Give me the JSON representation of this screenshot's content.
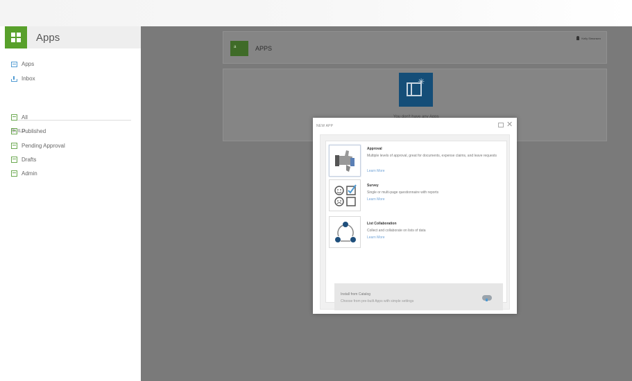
{
  "sidebar": {
    "title": "Apps",
    "items": [
      {
        "label": "Apps",
        "icon": "app-icon"
      },
      {
        "label": "Inbox",
        "icon": "inbox-icon"
      }
    ],
    "build_label": "BUILD",
    "build_items": [
      {
        "label": "All"
      },
      {
        "label": "Published"
      },
      {
        "label": "Pending Approval"
      },
      {
        "label": "Drafts"
      },
      {
        "label": "Admin"
      }
    ]
  },
  "header": {
    "logo_text": "a",
    "title": "APPS",
    "user": "Kelly Simonsen"
  },
  "mid": {
    "text": "You don't have any Apps"
  },
  "modal": {
    "title": "NEW APP",
    "options": [
      {
        "title": "Approval",
        "description": "Multiple levels of approval, great for documents, expense claims, and leave requests",
        "link": "Learn More"
      },
      {
        "title": "Survey",
        "description": "Single or multi-page questionnaire with reports",
        "link": "Learn More"
      },
      {
        "title": "List Collaboration",
        "description": "Collect and collaborate on lists of data",
        "link": "Learn More"
      }
    ],
    "catalog": {
      "title": "Install from Catalog",
      "description": "Choose from pre-built Apps with simple settings"
    }
  },
  "colors": {
    "accent": "#58a02b",
    "overlay": "#7a7a7a",
    "tile": "#154e78",
    "link": "#6fa2d6"
  }
}
